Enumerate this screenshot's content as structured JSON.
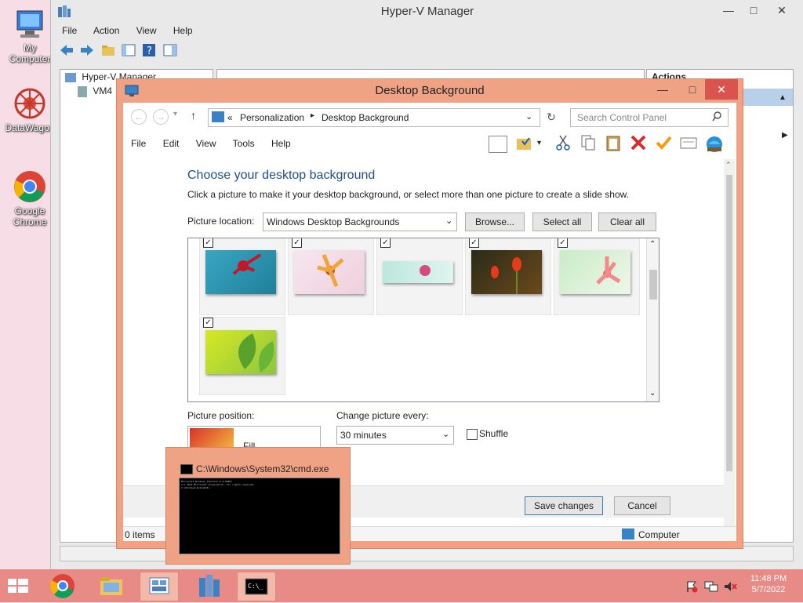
{
  "desktop": {
    "icons": [
      {
        "label": "My Computer",
        "icon": "computer-icon"
      },
      {
        "label": "DataWagon",
        "icon": "datawagon-icon"
      },
      {
        "label": "Google Chrome",
        "icon": "chrome-icon"
      }
    ]
  },
  "hyperv": {
    "title": "Hyper-V Manager",
    "menu": [
      "File",
      "Action",
      "View",
      "Help"
    ],
    "tree": {
      "root": "Hyper-V Manager",
      "child": "VM4"
    },
    "actions_header": "Actions"
  },
  "desktop_background": {
    "title": "Desktop Background",
    "breadcrumb": {
      "prefix": "«",
      "items": [
        "Personalization",
        "Desktop Background"
      ]
    },
    "search_placeholder": "Search Control Panel",
    "menu": [
      "File",
      "Edit",
      "View",
      "Tools",
      "Help"
    ],
    "heading": "Choose your desktop background",
    "subtext": "Click a picture to make it your desktop background, or select more than one picture to create a slide show.",
    "picture_location_label": "Picture location:",
    "picture_location_value": "Windows Desktop Backgrounds",
    "browse_label": "Browse...",
    "select_all_label": "Select all",
    "clear_all_label": "Clear all",
    "thumbnails": [
      {
        "checked": true,
        "name": "flower-teal"
      },
      {
        "checked": true,
        "name": "flower-pink-yellow"
      },
      {
        "checked": true,
        "name": "flower-mint"
      },
      {
        "checked": true,
        "name": "tulips-dark"
      },
      {
        "checked": true,
        "name": "flower-green-pink"
      },
      {
        "checked": true,
        "name": "leaves-green"
      }
    ],
    "picture_position_label": "Picture position:",
    "picture_position_value": "Fill",
    "change_picture_label": "Change picture every:",
    "change_picture_value": "30 minutes",
    "shuffle_label": "Shuffle",
    "save_label": "Save changes",
    "cancel_label": "Cancel",
    "status_items": "0 items",
    "status_computer": "Computer"
  },
  "cmd": {
    "title": "C:\\Windows\\System32\\cmd.exe",
    "lines": [
      "Microsoft Windows [Version 6.3.9600]",
      "(c) 2013 Microsoft Corporation. All rights reserved.",
      "",
      "C:\\Windows\\System32>"
    ]
  },
  "taskbar": {
    "time": "11:48 PM",
    "date": "5/7/2022"
  }
}
